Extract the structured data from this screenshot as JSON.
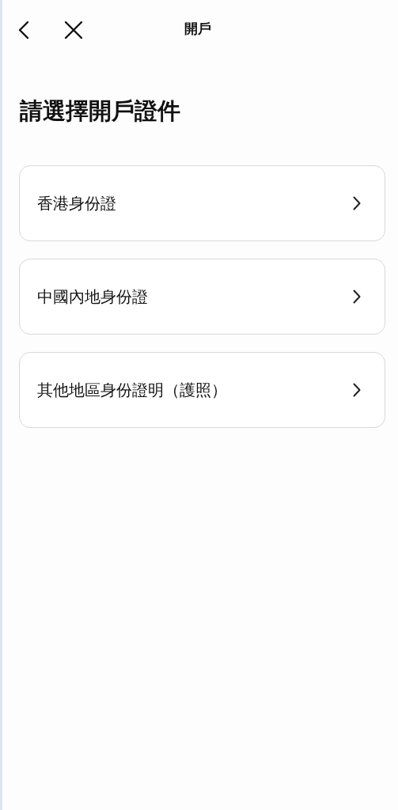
{
  "header": {
    "title": "開戶"
  },
  "heading": "請選擇開戶證件",
  "options": [
    {
      "label": "香港身份證"
    },
    {
      "label": "中國內地身份證"
    },
    {
      "label": "其他地區身份證明（護照）"
    }
  ]
}
